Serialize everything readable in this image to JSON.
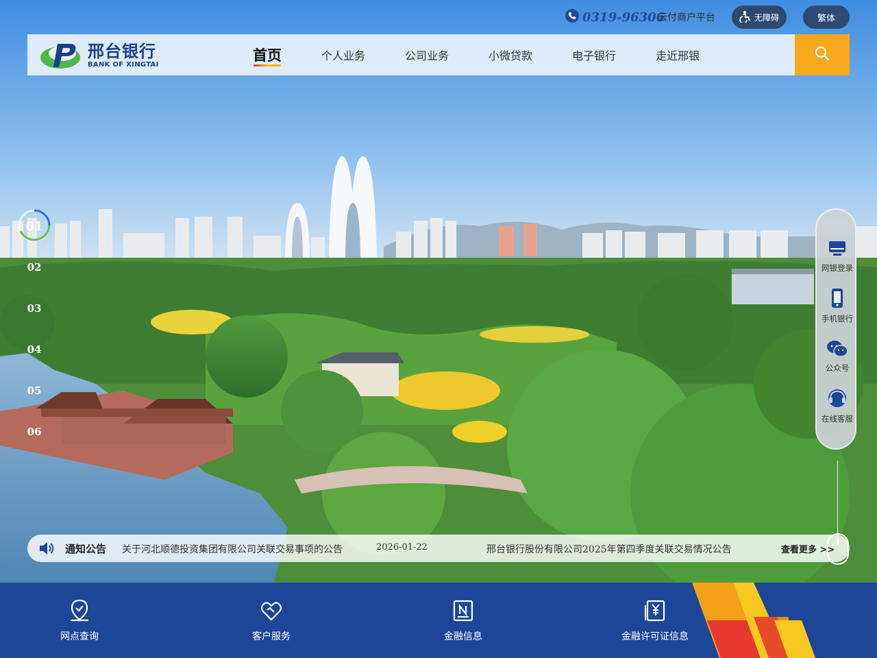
{
  "topbar": {
    "hotline": "0319-96306",
    "merchant_link": "云付商户平台",
    "accessibility_label": "无障碍",
    "traditional_label": "繁体"
  },
  "logo": {
    "name_cn": "邢台银行",
    "name_en": "BANK OF XINGTAI"
  },
  "nav": {
    "items": [
      {
        "label": "首页",
        "active": true
      },
      {
        "label": "个人业务"
      },
      {
        "label": "公司业务"
      },
      {
        "label": "小微贷款"
      },
      {
        "label": "电子银行"
      },
      {
        "label": "走近邢银"
      }
    ]
  },
  "slides": {
    "items": [
      "01",
      "02",
      "03",
      "04",
      "05",
      "06"
    ],
    "active_index": 0
  },
  "side_panel": {
    "items": [
      {
        "label": "网银登录",
        "icon": "monitor-icon"
      },
      {
        "label": "手机银行",
        "icon": "phone-icon"
      },
      {
        "label": "公众号",
        "icon": "wechat-icon"
      },
      {
        "label": "在线客服",
        "icon": "headset-icon"
      }
    ]
  },
  "notice": {
    "label": "通知公告",
    "item1_text": "关于河北顺德投资集团有限公司关联交易事项的公告",
    "item1_date": "2026-01-22",
    "item2_text": "邢台银行股份有限公司2025年第四季度关联交易情况公告",
    "more_label": "查看更多 >>"
  },
  "quick_links": {
    "items": [
      {
        "label": "网点查询",
        "icon": "location-icon"
      },
      {
        "label": "客户服务",
        "icon": "handshake-icon"
      },
      {
        "label": "金融信息",
        "icon": "news-icon"
      },
      {
        "label": "金融许可证信息",
        "icon": "license-icon"
      }
    ]
  },
  "colors": {
    "brand_blue": "#1d4699",
    "search_orange": "#f7a81b",
    "logo_green": "#4cb748"
  }
}
